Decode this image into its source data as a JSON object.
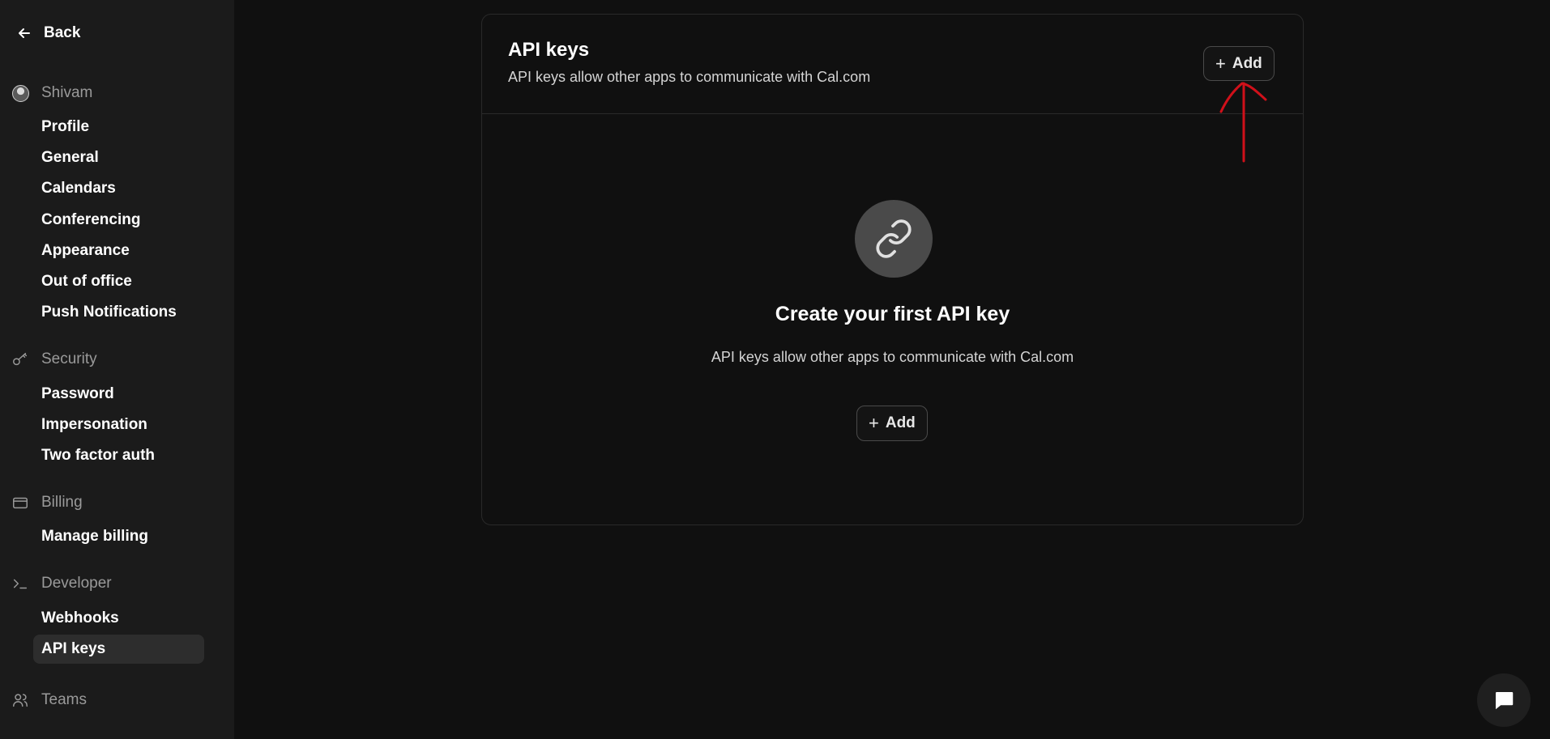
{
  "sidebar": {
    "back_label": "Back",
    "user": {
      "name": "Shivam",
      "items": [
        "Profile",
        "General",
        "Calendars",
        "Conferencing",
        "Appearance",
        "Out of office",
        "Push Notifications"
      ]
    },
    "security": {
      "label": "Security",
      "items": [
        "Password",
        "Impersonation",
        "Two factor auth"
      ]
    },
    "billing": {
      "label": "Billing",
      "items": [
        "Manage billing"
      ]
    },
    "developer": {
      "label": "Developer",
      "items": [
        "Webhooks",
        "API keys"
      ]
    },
    "teams": {
      "label": "Teams"
    },
    "active_item": "API keys"
  },
  "main": {
    "title": "API keys",
    "description": "API keys allow other apps to communicate with Cal.com",
    "add_label": "Add",
    "empty_state": {
      "icon": "link-icon",
      "title": "Create your first API key",
      "description": "API keys allow other apps to communicate with Cal.com",
      "add_label": "Add"
    }
  },
  "annotation": {
    "color": "#d0101a",
    "shape": "arrow-pointing-up"
  },
  "colors": {
    "background": "#101010",
    "sidebar": "#1b1b1b",
    "active_item": "#2d2d2d"
  }
}
